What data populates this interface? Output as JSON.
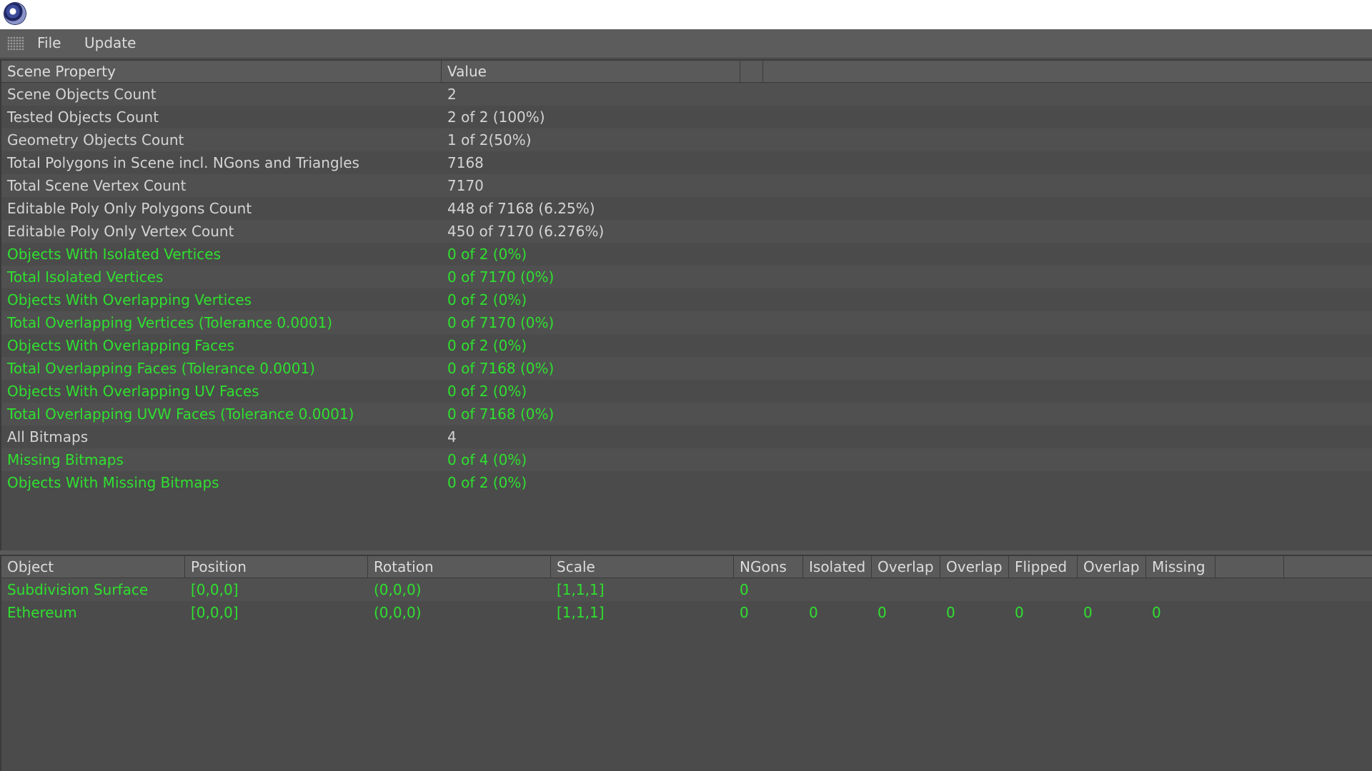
{
  "menu": {
    "file": "File",
    "update": "Update"
  },
  "scene_table": {
    "headers": [
      "Scene Property",
      "Value"
    ],
    "rows": [
      {
        "property": "Scene Objects Count",
        "value": "2",
        "status": "normal"
      },
      {
        "property": "Tested Objects Count",
        "value": "2 of 2 (100%)",
        "status": "normal"
      },
      {
        "property": "Geometry Objects Count",
        "value": "1 of 2(50%)",
        "status": "normal"
      },
      {
        "property": "Total Polygons in Scene incl. NGons and Triangles",
        "value": "7168",
        "status": "normal"
      },
      {
        "property": "Total Scene Vertex Count",
        "value": "7170",
        "status": "normal"
      },
      {
        "property": "Editable Poly Only Polygons Count",
        "value": "448 of 7168 (6.25%)",
        "status": "normal"
      },
      {
        "property": "Editable Poly Only Vertex Count",
        "value": "450 of 7170 (6.276%)",
        "status": "normal"
      },
      {
        "property": "Objects With Isolated Vertices",
        "value": "0 of 2 (0%)",
        "status": "ok"
      },
      {
        "property": "Total Isolated Vertices",
        "value": "0 of 7170 (0%)",
        "status": "ok"
      },
      {
        "property": "Objects With Overlapping Vertices",
        "value": "0 of 2 (0%)",
        "status": "ok"
      },
      {
        "property": "Total Overlapping Vertices (Tolerance 0.0001)",
        "value": "0 of 7170 (0%)",
        "status": "ok"
      },
      {
        "property": "Objects With Overlapping Faces",
        "value": "0 of 2 (0%)",
        "status": "ok"
      },
      {
        "property": "Total Overlapping Faces (Tolerance 0.0001)",
        "value": "0 of 7168 (0%)",
        "status": "ok"
      },
      {
        "property": "Objects With Overlapping UV Faces",
        "value": "0 of 2 (0%)",
        "status": "ok"
      },
      {
        "property": "Total Overlapping UVW Faces (Tolerance 0.0001)",
        "value": "0 of 7168 (0%)",
        "status": "ok"
      },
      {
        "property": "All Bitmaps",
        "value": "4",
        "status": "normal"
      },
      {
        "property": "Missing Bitmaps",
        "value": "0 of 4 (0%)",
        "status": "ok"
      },
      {
        "property": "Objects With Missing Bitmaps",
        "value": "0 of 2 (0%)",
        "status": "ok"
      }
    ]
  },
  "object_table": {
    "headers": [
      "Object",
      "Position",
      "Rotation",
      "Scale",
      "NGons",
      "Isolated",
      "Overlap",
      "Overlap",
      "Flipped",
      "Overlap",
      "Missing"
    ],
    "rows": [
      [
        "Subdivision Surface",
        "[0,0,0]",
        "(0,0,0)",
        "[1,1,1]",
        "0",
        "",
        "",
        "",
        "",
        "",
        ""
      ],
      [
        "Ethereum",
        "[0,0,0]",
        "(0,0,0)",
        "[1,1,1]",
        "0",
        "0",
        "0",
        "0",
        "0",
        "0",
        "0"
      ]
    ]
  },
  "colors": {
    "ok_text": "#2fe02f",
    "normal_text": "#d4d4d4",
    "background": "#4b4b4b"
  },
  "icons": {
    "app": "cinema4d-app-icon",
    "grip": "menu-grip-icon"
  }
}
